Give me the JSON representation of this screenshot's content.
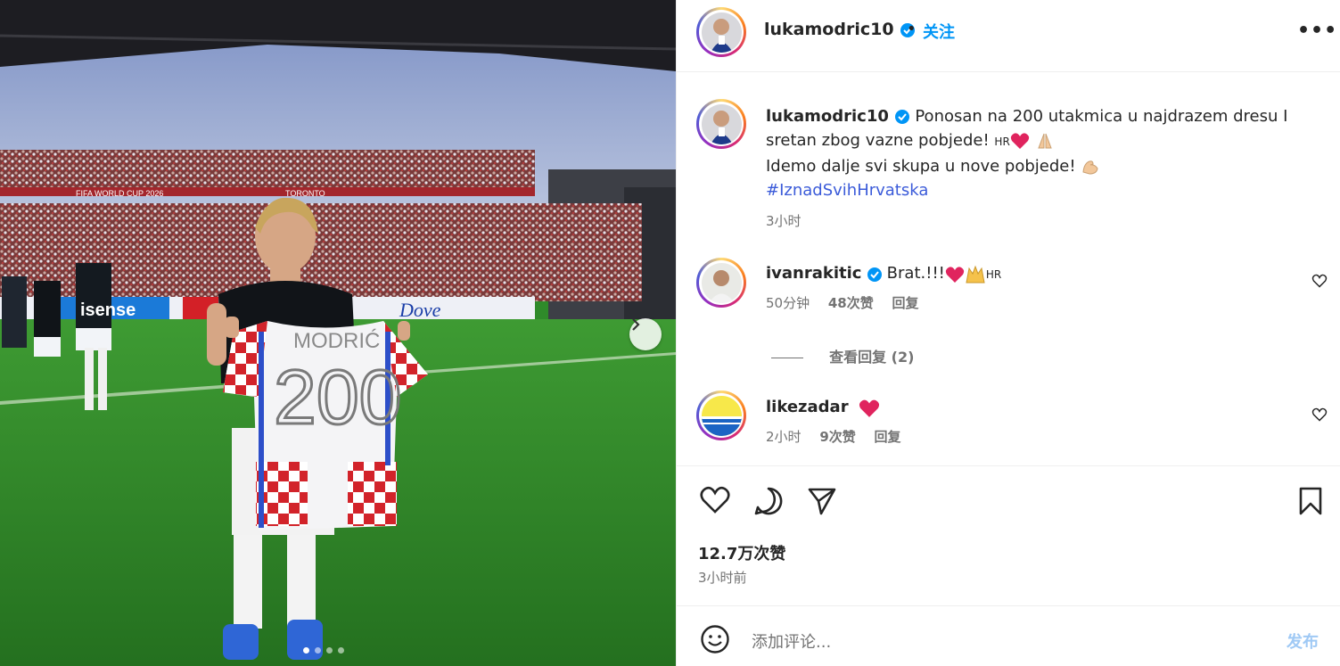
{
  "post": {
    "username": "lukamodric10",
    "follow_label": "关注",
    "separator": "•",
    "more_label": "•••"
  },
  "photo": {
    "shirt_name": "MODRIĆ",
    "shirt_number": "200",
    "board_text_1": "Dove",
    "board_text_2": "isense",
    "banner_text": "FIFA WORLD CUP 2026",
    "banner_text_2": "TORONTO",
    "carousel_dots": 4,
    "active_dot": 0
  },
  "caption": {
    "username": "lukamodric10",
    "line1": "Ponosan na 200 utakmica u najdrazem dresu I",
    "line2_text": "sretan zbog vazne pobjede! ",
    "flag_hr": "HR",
    "line3": "Idemo dalje svi skupa u nove pobjede! ",
    "hashtag": "#IznadSvihHrvatska",
    "time": "3小时"
  },
  "comments": [
    {
      "username": "ivanrakitic",
      "text": "Brat.!!!",
      "flag": "HR",
      "time": "50分钟",
      "likes": "48次赞",
      "reply": "回复",
      "view_replies": "查看回复 (2)"
    },
    {
      "username": "likezadar",
      "text": "",
      "time": "2小时",
      "likes": "9次赞",
      "reply": "回复"
    }
  ],
  "footer": {
    "like_count": "12.7万次赞",
    "posted": "3小时前",
    "comment_placeholder": "添加评论...",
    "publish_label": "发布"
  },
  "colors": {
    "accent_blue": "#0095f6",
    "hashtag": "#3b5bd9",
    "heart_red": "#e0245e",
    "muted": "#737373"
  }
}
